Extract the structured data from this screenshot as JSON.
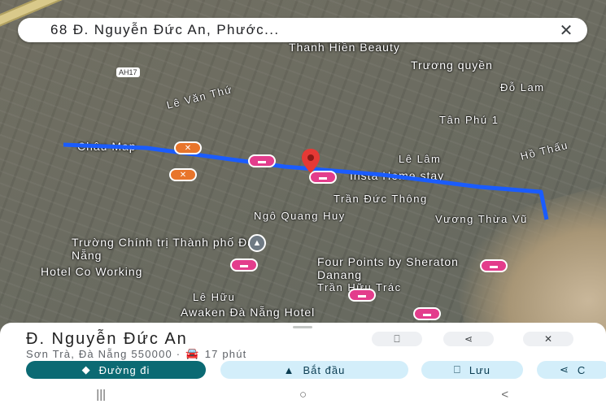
{
  "search": {
    "query": "68 Đ. Nguyễn Đức An, Phước..."
  },
  "map": {
    "highway_badge": "AH17",
    "streets": [
      "Lê Văn Thứ",
      "Tân Phú 1",
      "Lê Lâm",
      "Hồ Thấu",
      "Trần Đức Thông",
      "Ngô Quang Huy",
      "Vương Thừa Vũ",
      "Trần Hữu Trác",
      "Lê Hữu",
      "Đỗ Lam"
    ],
    "pois": [
      "Thanh Hiền Beauty",
      "Trương quyền",
      "Châu Map",
      "Insta Home stay",
      "Trường Chính trị Thành phố Đà Nẵng",
      "Hotel Co Working",
      "Four Points by Sheraton Danang",
      "Awaken Đà Nẵng Hotel"
    ],
    "icons": {
      "restaurant": "fork-knife-icon",
      "hotel": "bed-icon",
      "school": "graduation-cap-icon",
      "marker": "red-pin-icon"
    },
    "colors": {
      "route": "#1a5cff",
      "restaurant": "#e8752b",
      "hotel": "#e33d8c",
      "marker": "#e53935"
    }
  },
  "place": {
    "title": "Đ. Nguyễn Đức An",
    "subtitle": "Sơn Trà, Đà Nẵng 550000 ·",
    "travel_time": "17 phút"
  },
  "actions": {
    "directions": "Đường đi",
    "start": "Bắt đầu",
    "save": "Lưu",
    "share": "C"
  },
  "system_nav": {
    "recent": "|||",
    "home": "○",
    "back": "<"
  }
}
